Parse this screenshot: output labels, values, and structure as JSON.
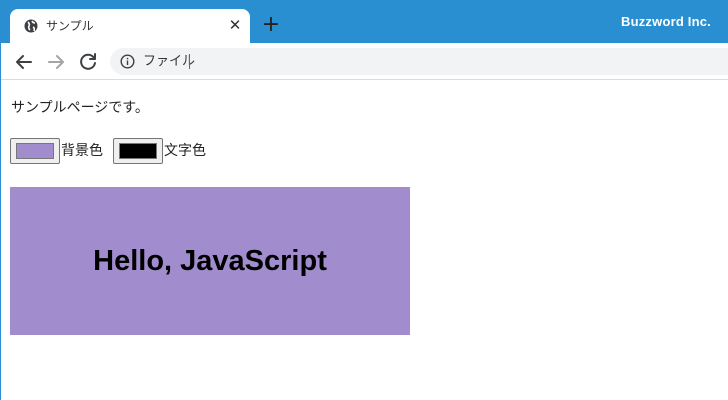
{
  "browser": {
    "tab_title": "サンプル",
    "tab_close": "✕",
    "new_tab": "+",
    "brand": "Buzzword Inc.",
    "address_label": "ファイル",
    "accent_color": "#2a8fd0"
  },
  "page": {
    "intro": "サンプルページです。",
    "background_color_label": "背景色",
    "text_color_label": "文字色",
    "background_color_value": "#a18dce",
    "text_color_value": "#000000",
    "box_text": "Hello, JavaScript"
  }
}
